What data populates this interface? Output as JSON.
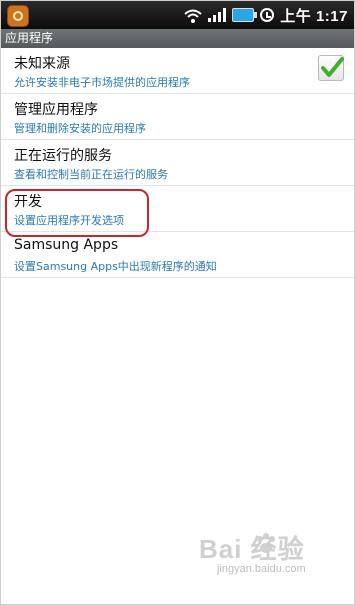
{
  "status_bar": {
    "time": "上午 1:17",
    "icons": [
      "app-badge-icon",
      "wifi-icon",
      "signal-icon",
      "battery-icon",
      "alarm-icon"
    ],
    "battery_color": "#2aa6e6"
  },
  "title_bar": {
    "title": "应用程序"
  },
  "items": [
    {
      "title": "未知来源",
      "subtitle": "允许安装非电子市场提供的应用程序",
      "checked": true
    },
    {
      "title": "管理应用程序",
      "subtitle": "管理和删除安装的应用程序"
    },
    {
      "title": "正在运行的服务",
      "subtitle": "查看和控制当前正在运行的服务"
    },
    {
      "title": "开发",
      "subtitle": "设置应用程序开发选项"
    },
    {
      "title": "Samsung Apps",
      "subtitle": "设置Samsung Apps中出现新程序的通知"
    }
  ],
  "colors": {
    "subtitle": "#2b7bb0",
    "highlight": "#c6262e",
    "check": "#3fae2a"
  },
  "watermark": {
    "logo": "Bai  经验",
    "url": "jingyan.baidu.com"
  }
}
